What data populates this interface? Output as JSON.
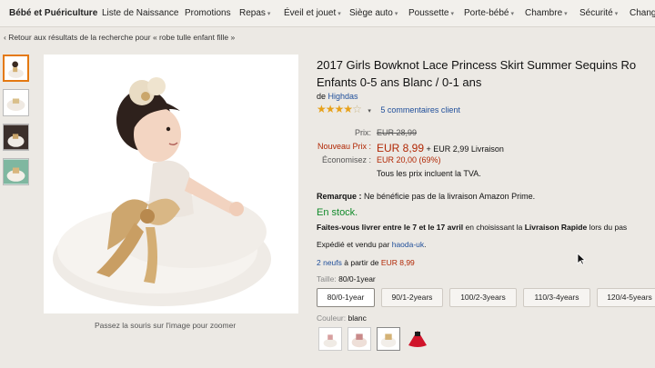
{
  "nav": {
    "items": [
      {
        "label": "Bébé et Puériculture",
        "caret": false
      },
      {
        "label": "Liste de Naissance",
        "caret": false
      },
      {
        "label": "Promotions",
        "caret": false
      },
      {
        "label": "Repas",
        "caret": true
      },
      {
        "label": "Éveil et jouet",
        "caret": true
      },
      {
        "label": "Siège auto",
        "caret": true
      },
      {
        "label": "Poussette",
        "caret": true
      },
      {
        "label": "Porte-bébé",
        "caret": true
      },
      {
        "label": "Chambre",
        "caret": true
      },
      {
        "label": "Sécurité",
        "caret": true
      },
      {
        "label": "Change",
        "caret": false
      }
    ]
  },
  "breadcrumb": "‹ Retour aux résultats de la recherche pour « robe tulle enfant fille »",
  "gallery": {
    "zoom_hint": "Passez la souris sur l'image pour zoomer"
  },
  "product": {
    "title_line1": "2017 Girls Bowknot Lace Princess Skirt Summer Sequins Ro",
    "title_line2": "Enfants 0-5 ans Blanc / 0-1 ans",
    "by": "de",
    "brand": "Highdas",
    "rating": 4,
    "rating_max": 5,
    "reviews": "5 commentaires client",
    "price_label": "Prix:",
    "price": "EUR 28,99",
    "new_price_label": "Nouveau Prix :",
    "new_price": "EUR 8,99",
    "shipping": "+ EUR 2,99 Livraison",
    "savings_label": "Économisez :",
    "savings": "EUR 20,00 (69%)",
    "tax_note": "Tous les prix incluent la TVA.",
    "remark_label": "Remarque :",
    "remark": "Ne bénéficie pas de la livraison Amazon Prime.",
    "stock": "En stock.",
    "delivery_a": "Faites-vous livrer entre le 7 et le 17 avril",
    "delivery_b": "en choisissant la",
    "delivery_c": "Livraison Rapide",
    "delivery_d": "lors du pas",
    "seller_prefix": "Expédié et vendu par",
    "seller": "haoda-uk",
    "offers_link": "2 neufs",
    "offers_text": "à partir de",
    "offers_price": "EUR 8,99",
    "size_label": "Taille:",
    "size_selected": "80/0-1year",
    "sizes": [
      "80/0-1year",
      "90/1-2years",
      "100/2-3years",
      "110/3-4years",
      "120/4-5years"
    ],
    "color_label": "Couleur:",
    "color_selected": "blanc"
  },
  "colors": {
    "accent": "#e47911",
    "link": "#1f4e9a",
    "price": "#b12704",
    "stock": "#118a2a",
    "star": "#e7a11a"
  },
  "icons": {
    "chevron": "chevron-down-icon",
    "cursor": "mouse-pointer-icon"
  }
}
